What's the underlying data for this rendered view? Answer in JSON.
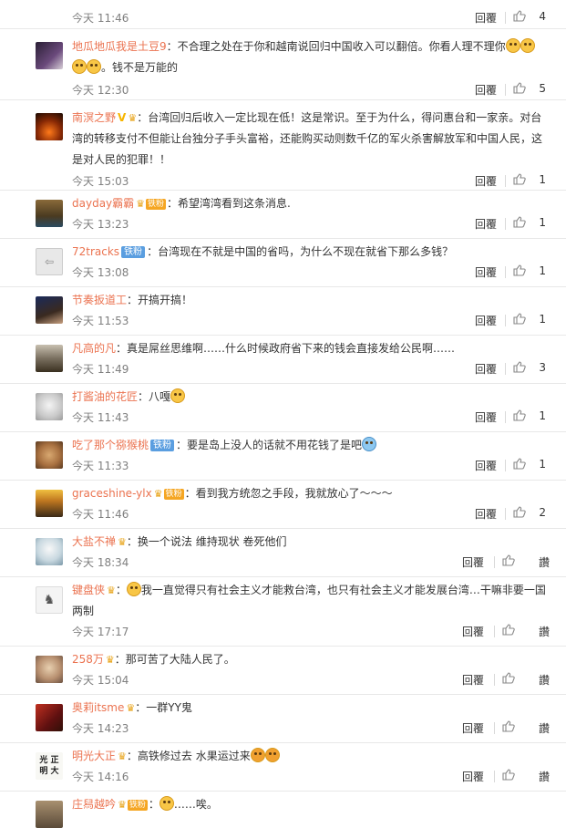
{
  "ui": {
    "reply_label": "回覆",
    "like_label_short": "讚"
  },
  "comments": [
    {
      "id": "c0",
      "user": "",
      "text": "",
      "time": "今天 11:46",
      "likes": "4"
    },
    {
      "id": "c1",
      "user": "地瓜地瓜我是土豆9",
      "text": "：不合理之处在于你和越南说回归中国收入可以翻倍。你看人理不理你",
      "text2": "。钱不是万能的",
      "time": "今天 12:30",
      "likes": "5"
    },
    {
      "id": "c2",
      "user": "南溟之野",
      "text": "：台湾回归后收入一定比现在低！这是常识。至于为什么，得问惠台和一家亲。对台湾的转移支付不但能让台独分子手头富裕，还能购买动则数千亿的军火杀害解放军和中国人民，这是对人民的犯罪！！",
      "time": "今天 15:03",
      "likes": "1"
    },
    {
      "id": "c3",
      "user": "dayday霸霸",
      "text": "：希望湾湾看到这条消息.",
      "time": "今天 13:23",
      "likes": "1"
    },
    {
      "id": "c4",
      "user": "72tracks",
      "fans": "铁粉",
      "text": "：台湾现在不就是中国的省吗，为什么不现在就省下那么多钱？",
      "time": "今天 13:08",
      "likes": "1"
    },
    {
      "id": "c5",
      "user": "节奏扳道工",
      "text": "：开搞开搞！",
      "time": "今天 11:53",
      "likes": "1"
    },
    {
      "id": "c6",
      "user": "凡高的凡",
      "text": "：真是屌丝思维啊……什么时候政府省下来的钱会直接发给公民啊……",
      "time": "今天 11:49",
      "likes": "3"
    },
    {
      "id": "c7",
      "user": "打酱油的花匠",
      "text": "：八嘎",
      "time": "今天 11:43",
      "likes": "1"
    },
    {
      "id": "c8",
      "user": "吃了那个猕猴桃",
      "fans": "铁粉",
      "text": "：要是岛上没人的话就不用花钱了是吧",
      "time": "今天 11:33",
      "likes": "1"
    },
    {
      "id": "c9",
      "user": "graceshine-ylx",
      "vip": "铁粉",
      "text": "：看到我方统忽之手段，我就放心了～～～",
      "time": "今天 11:46",
      "likes": "2"
    },
    {
      "id": "c10",
      "user": "大盐不禅",
      "text": "：换一个说法 维持现状 卷死他们",
      "time": "今天 18:34",
      "likes": "讚"
    },
    {
      "id": "c11",
      "user": "键盘侠",
      "text": "我一直觉得只有社会主义才能救台湾，也只有社会主义才能发展台湾…干嘛非要一国两制",
      "time": "今天 17:17",
      "likes": "讚"
    },
    {
      "id": "c12",
      "user": "258万",
      "text": "：那可苦了大陆人民了。",
      "time": "今天 15:04",
      "likes": "讚"
    },
    {
      "id": "c13",
      "user": "奥莉itsme",
      "text": "：一群YY鬼",
      "time": "今天 14:23",
      "likes": "讚"
    },
    {
      "id": "c14",
      "user": "明光大正",
      "text": "：高铁修过去 水果运过来",
      "time": "今天 14:16",
      "likes": "讚"
    },
    {
      "id": "c15",
      "user": "庄舄越吟",
      "vip": "铁粉",
      "text": "……唉。",
      "time": "",
      "likes": ""
    }
  ],
  "colors": {
    "username": "#eb7350",
    "time": "#808080",
    "divider": "#e8e8e8"
  }
}
